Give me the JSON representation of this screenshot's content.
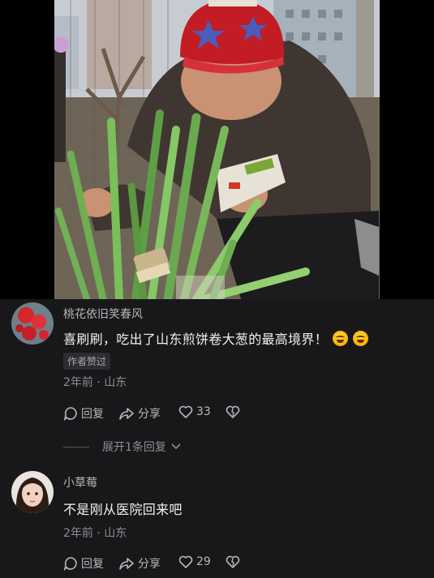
{
  "video": {
    "background_colors": {
      "sky": "#bfc6cf",
      "soil": "#5c5342",
      "letterbox": "#000000"
    },
    "scene_icon": "man-brushing-green-onions-photo"
  },
  "comments": [
    {
      "username": "桃花依旧笑春风",
      "text": "喜刷刷，吃出了山东煎饼卷大葱的最高境界！",
      "emoji_icons": [
        "laughing-tears-emoji",
        "laughing-tears-emoji"
      ],
      "badge": "作者赞过",
      "meta": "2年前 · 山东",
      "actions": {
        "reply": "回复",
        "share": "分享",
        "likes": "33"
      },
      "avatar_icon": "red-flowers-avatar"
    },
    {
      "username": "小草莓",
      "text": "不是刚从医院回来吧",
      "meta": "2年前 · 山东",
      "actions": {
        "reply": "回复",
        "share": "分享",
        "likes": "29"
      },
      "avatar_icon": "girl-portrait-avatar"
    }
  ],
  "expand_replies": "展开1条回复",
  "colors": {
    "background": "#18181a",
    "text": "#f2f2f2",
    "muted": "#8e8e93"
  }
}
